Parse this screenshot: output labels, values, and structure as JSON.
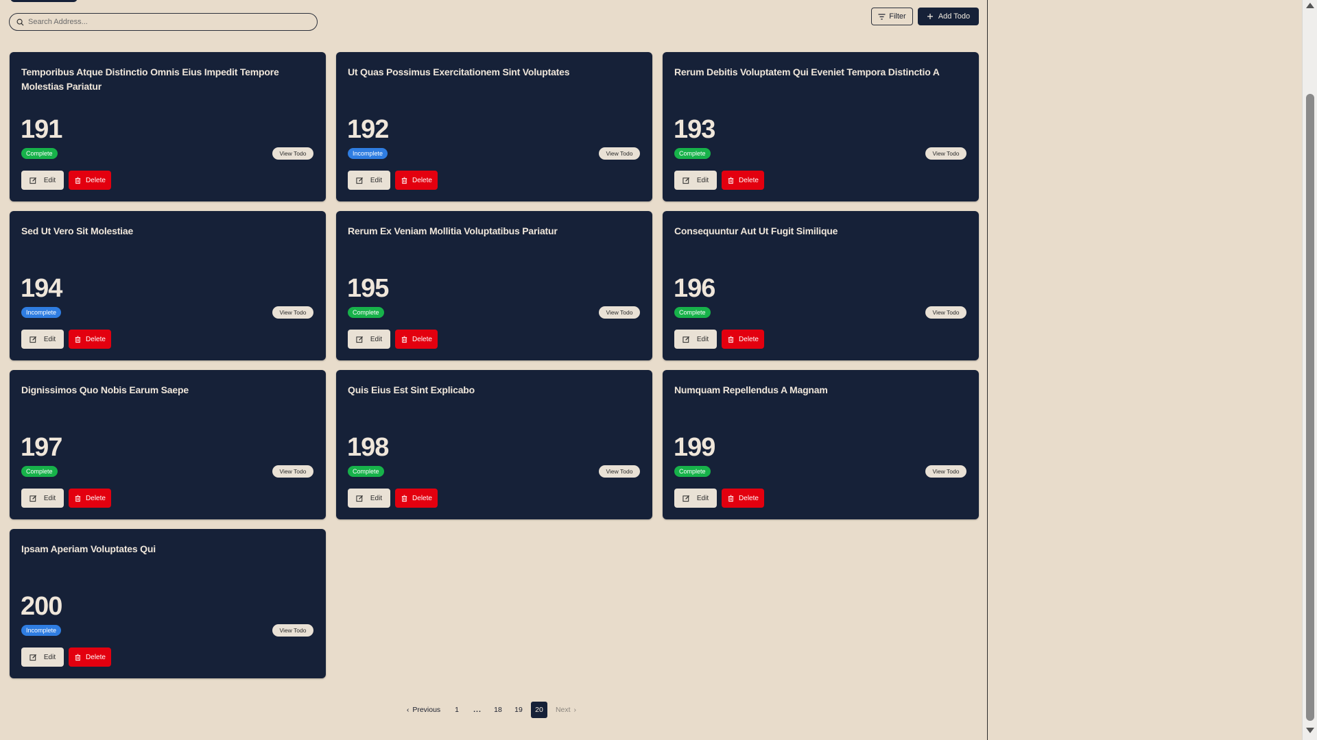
{
  "header": {
    "search_placeholder": "Search Address...",
    "filter_label": "Filter",
    "add_label": "Add Todo"
  },
  "cards": [
    {
      "title": "Temporibus Atque Distinctio Omnis Eius Impedit Tempore Molestias Pariatur",
      "id": "191",
      "status": "Complete",
      "view_label": "View Todo",
      "edit_label": "Edit",
      "delete_label": "Delete"
    },
    {
      "title": "Ut Quas Possimus Exercitationem Sint Voluptates",
      "id": "192",
      "status": "Incomplete",
      "view_label": "View Todo",
      "edit_label": "Edit",
      "delete_label": "Delete"
    },
    {
      "title": "Rerum Debitis Voluptatem Qui Eveniet Tempora Distinctio A",
      "id": "193",
      "status": "Complete",
      "view_label": "View Todo",
      "edit_label": "Edit",
      "delete_label": "Delete"
    },
    {
      "title": "Sed Ut Vero Sit Molestiae",
      "id": "194",
      "status": "Incomplete",
      "view_label": "View Todo",
      "edit_label": "Edit",
      "delete_label": "Delete"
    },
    {
      "title": "Rerum Ex Veniam Mollitia Voluptatibus Pariatur",
      "id": "195",
      "status": "Complete",
      "view_label": "View Todo",
      "edit_label": "Edit",
      "delete_label": "Delete"
    },
    {
      "title": "Consequuntur Aut Ut Fugit Similique",
      "id": "196",
      "status": "Complete",
      "view_label": "View Todo",
      "edit_label": "Edit",
      "delete_label": "Delete"
    },
    {
      "title": "Dignissimos Quo Nobis Earum Saepe",
      "id": "197",
      "status": "Complete",
      "view_label": "View Todo",
      "edit_label": "Edit",
      "delete_label": "Delete"
    },
    {
      "title": "Quis Eius Est Sint Explicabo",
      "id": "198",
      "status": "Complete",
      "view_label": "View Todo",
      "edit_label": "Edit",
      "delete_label": "Delete"
    },
    {
      "title": "Numquam Repellendus A Magnam",
      "id": "199",
      "status": "Complete",
      "view_label": "View Todo",
      "edit_label": "Edit",
      "delete_label": "Delete"
    },
    {
      "title": "Ipsam Aperiam Voluptates Qui",
      "id": "200",
      "status": "Incomplete",
      "view_label": "View Todo",
      "edit_label": "Edit",
      "delete_label": "Delete"
    }
  ],
  "pagination": {
    "previous_label": "Previous",
    "pages": [
      "1",
      "...",
      "18",
      "19",
      "20"
    ],
    "current_page": "20",
    "next_label": "Next"
  },
  "colors": {
    "background": "#e8dccb",
    "card": "#162138",
    "complete": "#17b24a",
    "incomplete": "#2f7de1",
    "delete": "#e3000f"
  }
}
